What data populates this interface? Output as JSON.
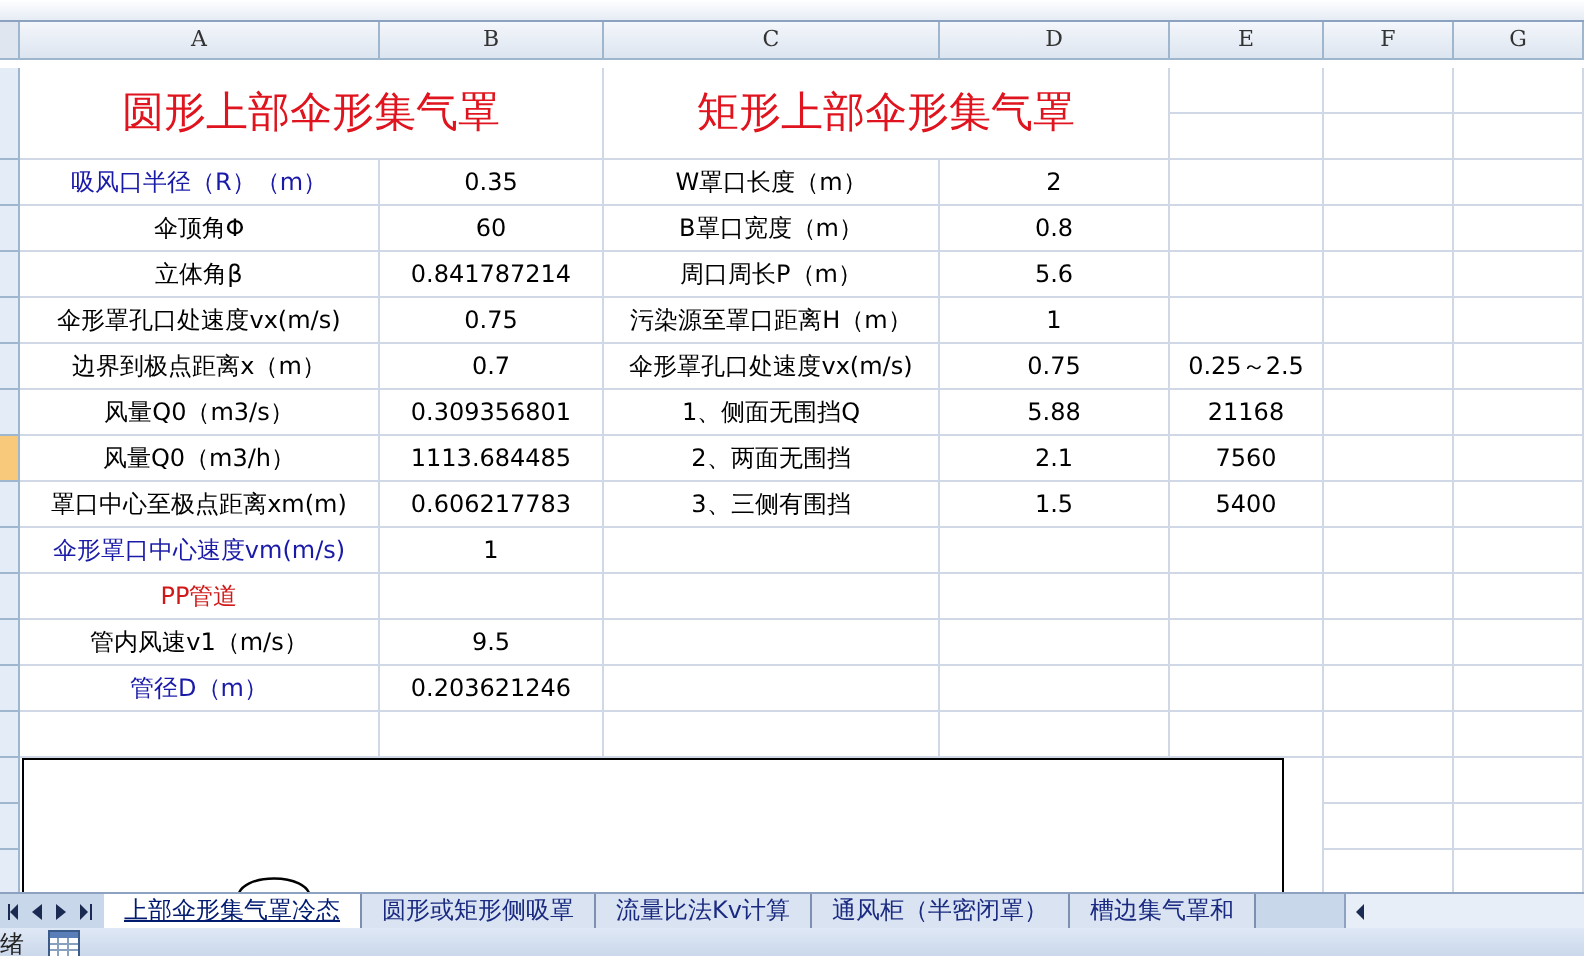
{
  "columns": [
    "A",
    "B",
    "C",
    "D",
    "E",
    "F",
    "G"
  ],
  "titles": [
    {
      "text": "圆形上部伞形集气罩",
      "color": "#e0141e"
    },
    {
      "text": "矩形上部伞形集气罩",
      "color": "#e0141e"
    }
  ],
  "rows": [
    {
      "selected": false,
      "A": "吸风口半径（R）（m）",
      "color": "#1a1aa8",
      "B": "0.35",
      "C": "W罩口长度（m）",
      "D": "2"
    },
    {
      "selected": false,
      "A": "伞顶角Φ",
      "B": "60",
      "C": "B罩口宽度（m）",
      "D": "0.8"
    },
    {
      "selected": false,
      "A": "立体角β",
      "B": "0.841787214",
      "C": "周口周长P（m）",
      "D": "5.6"
    },
    {
      "selected": false,
      "A": "伞形罩孔口处速度vx(m/s)",
      "B": "0.75",
      "C": "污染源至罩口距离H（m）",
      "D": "1"
    },
    {
      "selected": false,
      "A": "边界到极点距离x（m）",
      "B": "0.7",
      "C": "伞形罩孔口处速度vx(m/s)",
      "D": "0.75",
      "E": "0.25～2.5"
    },
    {
      "selected": false,
      "A": "风量Q0（m3/s）",
      "B": "0.309356801",
      "C": "1、侧面无围挡Q",
      "D": "5.88",
      "E": "21168"
    },
    {
      "selected": true,
      "A": "风量Q0（m3/h）",
      "B": "1113.684485",
      "C": "2、两面无围挡",
      "D": "2.1",
      "E": "7560"
    },
    {
      "selected": false,
      "A": "罩口中心至极点距离xm(m)",
      "B": "0.606217783",
      "C": "3、三侧有围挡",
      "D": "1.5",
      "E": "5400"
    },
    {
      "selected": false,
      "A": "伞形罩口中心速度vm(m/s)",
      "color": "#1a1aa8",
      "B": "1"
    },
    {
      "selected": false,
      "A": "PP管道",
      "color": "#d01818"
    },
    {
      "selected": false,
      "A": "管内风速v1（m/s）",
      "B": "9.5"
    },
    {
      "selected": false,
      "A": "管径D（m）",
      "color": "#1a1aa8",
      "B": "0.203621246"
    }
  ],
  "sheet_tabs": [
    {
      "label": "上部伞形集气罩冷态",
      "selected": true
    },
    {
      "label": "圆形或矩形侧吸罩",
      "selected": false
    },
    {
      "label": "流量比法Kv计算",
      "selected": false
    },
    {
      "label": "通风柜（半密闭罩）",
      "selected": false
    },
    {
      "label": "槽边集气罩和",
      "selected": false
    }
  ],
  "status_bar": {
    "text": "绪"
  }
}
